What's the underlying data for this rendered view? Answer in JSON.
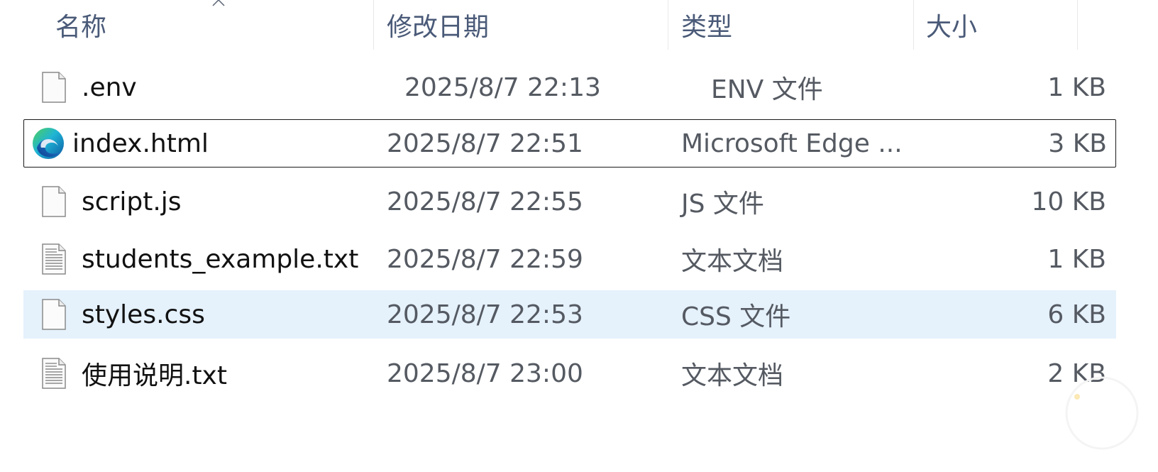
{
  "header": {
    "name_label": "名称",
    "date_label": "修改日期",
    "type_label": "类型",
    "size_label": "大小",
    "sort_icon": "chevron-up-icon"
  },
  "files": [
    {
      "name": ".env",
      "date": "2025/8/7 22:13",
      "type": "ENV 文件",
      "size": "1 KB",
      "icon": "blank-file-icon"
    },
    {
      "name": "index.html",
      "date": "2025/8/7 22:51",
      "type": "Microsoft Edge ...",
      "size": "3 KB",
      "icon": "microsoft-edge-icon"
    },
    {
      "name": "script.js",
      "date": "2025/8/7 22:55",
      "type": "JS 文件",
      "size": "10 KB",
      "icon": "blank-file-icon"
    },
    {
      "name": "students_example.txt",
      "date": "2025/8/7 22:59",
      "type": "文本文档",
      "size": "1 KB",
      "icon": "text-file-icon"
    },
    {
      "name": "styles.css",
      "date": "2025/8/7 22:53",
      "type": "CSS 文件",
      "size": "6 KB",
      "icon": "blank-file-icon"
    },
    {
      "name": "使用说明.txt",
      "date": "2025/8/7 23:00",
      "type": "文本文档",
      "size": "2 KB",
      "icon": "text-file-icon"
    }
  ],
  "state": {
    "focused_row": 1,
    "selected_row": 4
  },
  "colors": {
    "header_text": "#4a5a78",
    "selected_bg": "#e5f1fb",
    "focus_border": "#1a1a1a"
  }
}
